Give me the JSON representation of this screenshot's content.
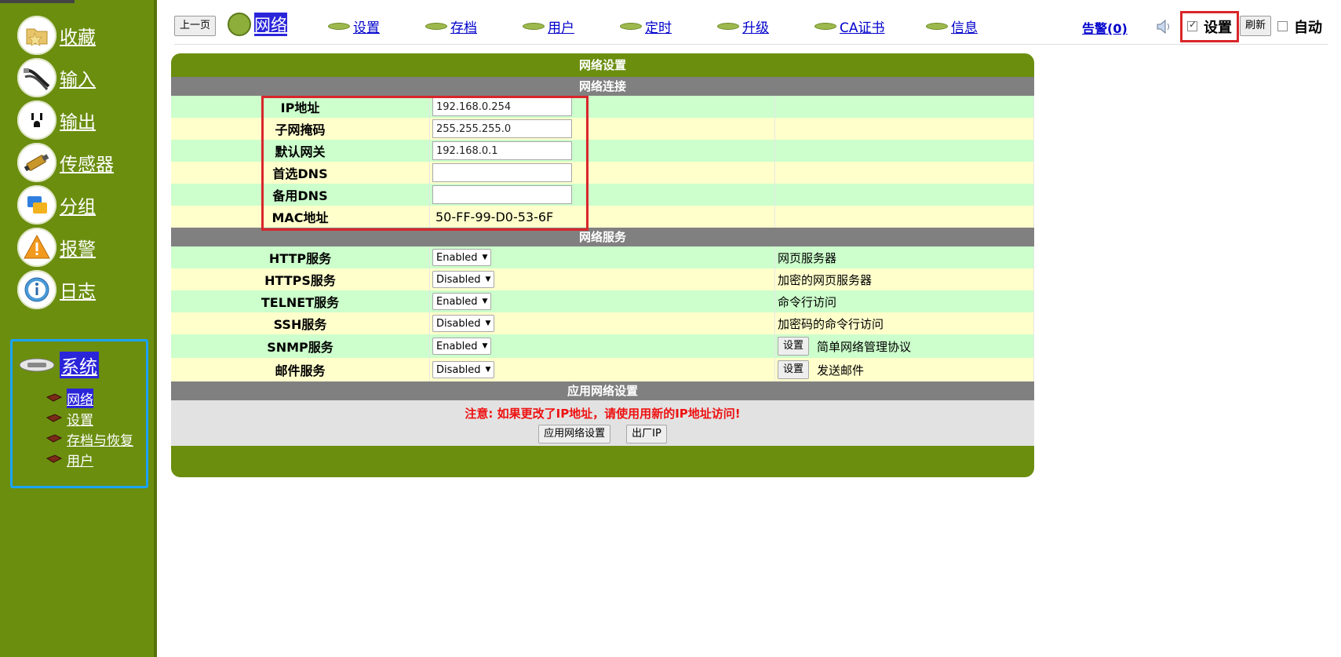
{
  "sidebar": {
    "items": [
      {
        "label": "收藏",
        "icon": "folder-icon"
      },
      {
        "label": "输入",
        "icon": "input-cable-icon"
      },
      {
        "label": "输出",
        "icon": "power-outlet-icon"
      },
      {
        "label": "传感器",
        "icon": "sensor-icon"
      },
      {
        "label": "分组",
        "icon": "group-icon"
      },
      {
        "label": "报警",
        "icon": "warning-icon"
      },
      {
        "label": "日志",
        "icon": "info-icon"
      },
      {
        "label": "系统",
        "icon": "system-device-icon"
      }
    ],
    "sub_items": [
      {
        "label": "网络"
      },
      {
        "label": "设置"
      },
      {
        "label": "存档与恢复"
      },
      {
        "label": "用户"
      }
    ]
  },
  "topnav": {
    "prev_label": "上一页",
    "current": "网络",
    "links": [
      "设置",
      "存档",
      "用户",
      "定时",
      "升级",
      "CA证书",
      "信息"
    ],
    "alarm": "告警(0)",
    "settings_label": "设置",
    "settings_checked": true,
    "refresh_label": "刷新",
    "auto_label": "自动",
    "auto_checked": false
  },
  "panel": {
    "title": "网络设置",
    "connection": {
      "header": "网络连接",
      "ip_label": "IP地址",
      "ip_value": "192.168.0.254",
      "mask_label": "子网掩码",
      "mask_value": "255.255.255.0",
      "gateway_label": "默认网关",
      "gateway_value": "192.168.0.1",
      "dns1_label": "首选DNS",
      "dns1_value": "",
      "dns2_label": "备用DNS",
      "dns2_value": "",
      "mac_label": "MAC地址",
      "mac_value": "50-FF-99-D0-53-6F"
    },
    "services": {
      "header": "网络服务",
      "rows": [
        {
          "name": "HTTP服务",
          "state": "Enabled",
          "desc": "网页服务器",
          "button": ""
        },
        {
          "name": "HTTPS服务",
          "state": "Disabled",
          "desc": "加密的网页服务器",
          "button": ""
        },
        {
          "name": "TELNET服务",
          "state": "Enabled",
          "desc": "命令行访问",
          "button": ""
        },
        {
          "name": "SSH服务",
          "state": "Disabled",
          "desc": "加密码的命令行访问",
          "button": ""
        },
        {
          "name": "SNMP服务",
          "state": "Enabled",
          "desc": "简单网络管理协议",
          "button": "设置"
        },
        {
          "name": "邮件服务",
          "state": "Disabled",
          "desc": "发送邮件",
          "button": "设置"
        }
      ]
    },
    "apply": {
      "header": "应用网络设置",
      "warning": "注意: 如果更改了IP地址，请使用用新的IP地址访问!",
      "apply_label": "应用网络设置",
      "factory_label": "出厂IP"
    }
  },
  "colors": {
    "sidebar_green": "#6b8e0f",
    "row_green": "#ccffcc",
    "row_yellow": "#ffffcc",
    "highlight_red": "#d9262a",
    "highlight_blue": "#1aa3ff",
    "link_blue": "#0000cc"
  }
}
